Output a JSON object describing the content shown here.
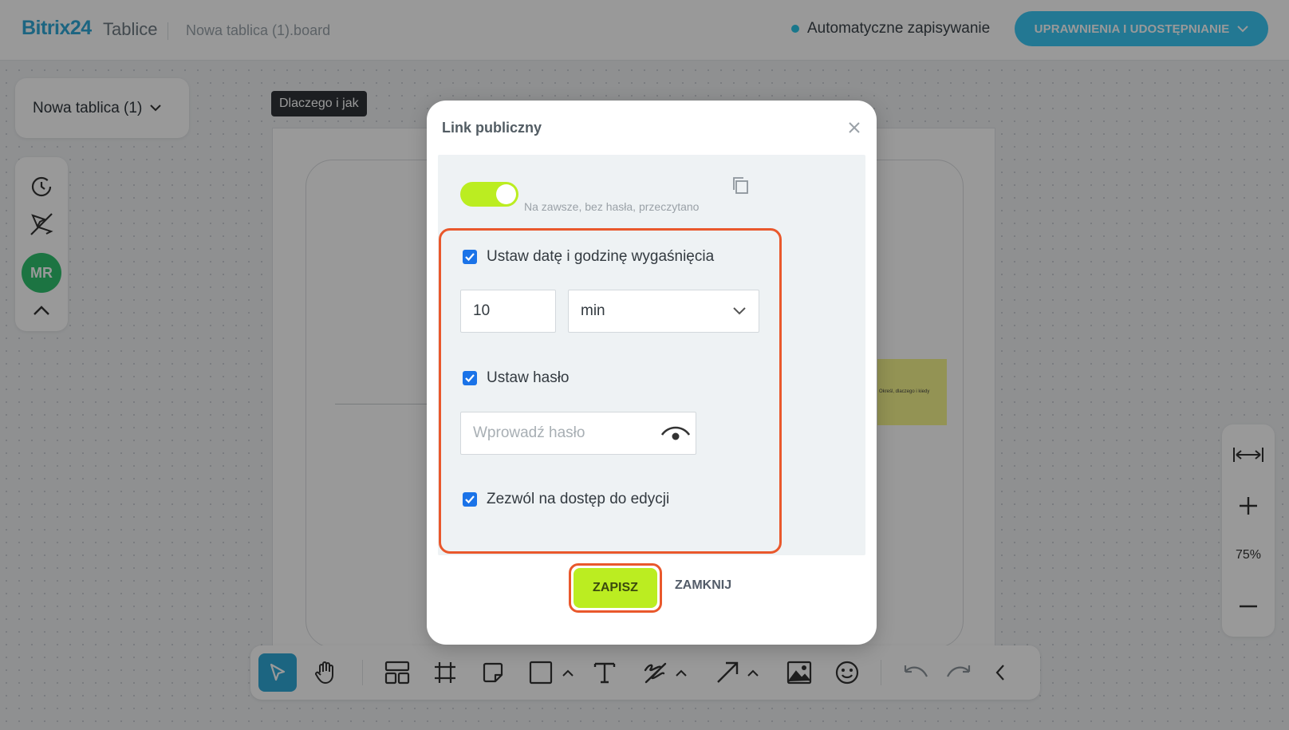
{
  "header": {
    "logo_brand": "Bitrix",
    "logo_num": "24",
    "product": "Tablice",
    "board_file": "Nowa tablica (1).board",
    "autosave": "Automatyczne zapisywanie",
    "share_button": "UPRAWNIENIA I UDOSTĘPNIANIE"
  },
  "sidebar": {
    "board_name": "Nowa tablica (1)",
    "avatar_initials": "MR"
  },
  "canvas": {
    "frame_label": "Dlaczego i jak",
    "sticky_text": "Określ, dlaczego i kiedy"
  },
  "zoom": {
    "level": "75%"
  },
  "modal": {
    "title": "Link publiczny",
    "toggle_caption": "Na zawsze, bez hasła, przeczytano",
    "toggle_on": true,
    "expiry_checkbox_label": "Ustaw datę i godzinę wygaśnięcia",
    "expiry_value": "10",
    "expiry_unit": "min",
    "password_checkbox_label": "Ustaw hasło",
    "password_placeholder": "Wprowadź hasło",
    "edit_checkbox_label": "Zezwól na dostęp do edycji",
    "save_button": "ZAPISZ",
    "close_button": "ZAMKNIJ"
  },
  "colors": {
    "accent": "#2fa8d8",
    "toggle": "#bbed21",
    "highlight": "#e9582c",
    "avatar": "#2fc26e"
  }
}
